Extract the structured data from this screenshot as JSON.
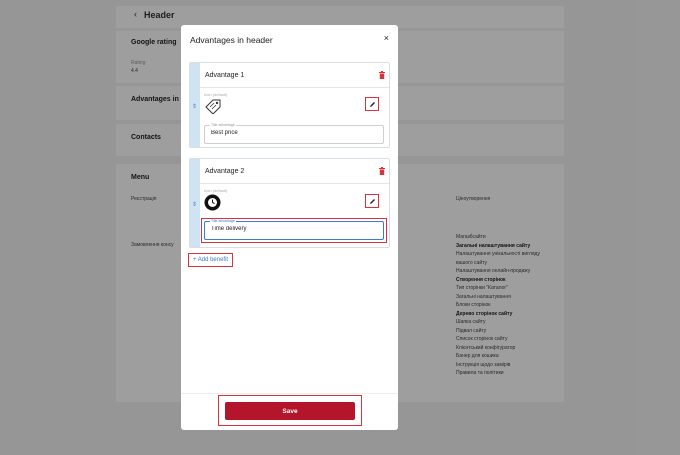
{
  "background": {
    "header_title": "Header",
    "google_rating": {
      "title": "Google rating",
      "rating_label": "Rating",
      "rating_value": "4.4"
    },
    "advantages_title": "Advantages in he",
    "contacts_title": "Contacts",
    "menu": {
      "title": "Menu",
      "left_items": [
        "Реєстрація",
        "Замовлення консу"
      ],
      "right_top": "Ціноутворення",
      "right_list": [
        {
          "text": "Магазбсайти",
          "bold": false
        },
        {
          "text": "Загальні налаштування сайту",
          "bold": true
        },
        {
          "text": "Налаштування унікальності вигляду",
          "bold": false
        },
        {
          "text": "вашого сайту",
          "bold": false
        },
        {
          "text": "Налаштування онлайн-продажу",
          "bold": false
        },
        {
          "text": "Створення сторінок",
          "bold": true
        },
        {
          "text": "Тип сторінки \"Каталог\"",
          "bold": false
        },
        {
          "text": "Загальні налаштування",
          "bold": false
        },
        {
          "text": "Блоки сторінок",
          "bold": false
        },
        {
          "text": "Дерево сторінок сайту",
          "bold": true
        },
        {
          "text": "Шапка сайту",
          "bold": false
        },
        {
          "text": "Підвал сайту",
          "bold": false
        },
        {
          "text": "Список сторінок сайту",
          "bold": false
        },
        {
          "text": "Клієнтський конфігуратор",
          "bold": false
        },
        {
          "text": "Банер для кошика",
          "bold": false
        },
        {
          "text": "Інструкція щодо замірів",
          "bold": false
        },
        {
          "text": "Правила та політики",
          "bold": false
        }
      ]
    }
  },
  "modal": {
    "title": "Advantages in header",
    "close": "×",
    "advantages": [
      {
        "name": "Advantage 1",
        "icon_label": "Icon (default)",
        "title_label": "Title advantage",
        "title_value": "Best price"
      },
      {
        "name": "Advantage 2",
        "icon_label": "Icon (default)",
        "title_label": "Title advantage",
        "title_value": "Time delivery"
      }
    ],
    "add_benefit": "+ Add benefit",
    "save": "Save"
  },
  "colors": {
    "accent": "#b5152b",
    "highlight": "#d8323c",
    "grip": "#cfe3f3",
    "link": "#3a7bd5"
  }
}
